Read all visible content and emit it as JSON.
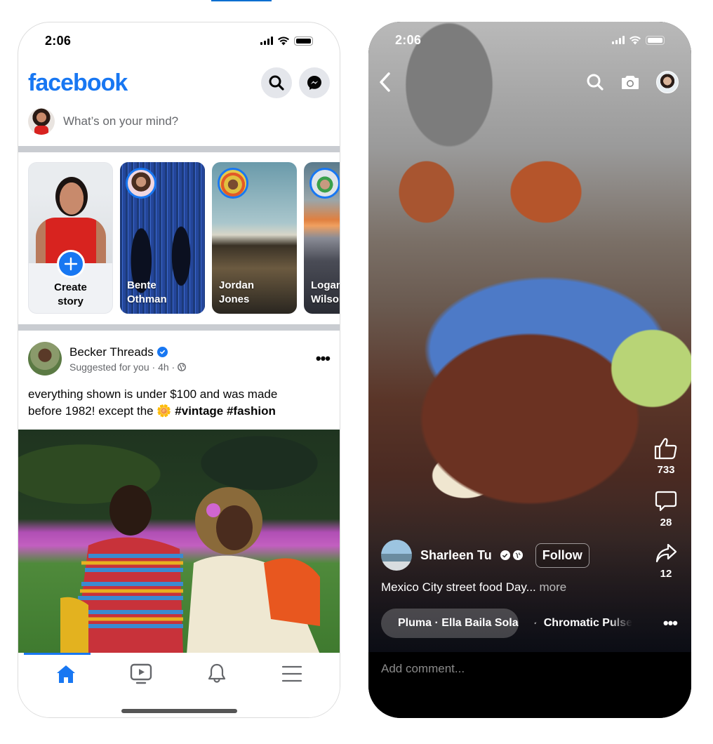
{
  "left_phone": {
    "status": {
      "time": "2:06"
    },
    "header": {
      "logo": "facebook",
      "search_icon": "search-icon",
      "messenger_icon": "messenger-icon"
    },
    "composer": {
      "placeholder": "What’s on your mind?"
    },
    "stories": [
      {
        "label_line1": "Create",
        "label_line2": "story",
        "type": "create"
      },
      {
        "label_line1": "Bente",
        "label_line2": "Othman"
      },
      {
        "label_line1": "Jordan",
        "label_line2": "Jones"
      },
      {
        "label_line1": "Logan",
        "label_line2": "Wilson"
      }
    ],
    "post": {
      "author": "Becker Threads",
      "verified": true,
      "meta": "Suggested for you · 4h ·",
      "text_line1": "everything shown is under $100 and was made",
      "text_line2_prefix": "before 1982! except the",
      "emoji": "🌼",
      "hashtags": "#vintage #fashion"
    },
    "tabbar": {
      "tabs": [
        {
          "name": "home",
          "active": true
        },
        {
          "name": "watch",
          "active": false
        },
        {
          "name": "notifications",
          "active": false
        },
        {
          "name": "menu",
          "active": false
        }
      ]
    }
  },
  "right_phone": {
    "status": {
      "time": "2:06"
    },
    "reel": {
      "author": "Sharleen Tu",
      "follow_label": "Follow",
      "caption": "Mexico City street food Day...",
      "caption_more": "more",
      "likes": "733",
      "comments": "28",
      "shares": "12",
      "music": "Pluma · Ella Baila Sola",
      "effect": "Chromatic Pulse"
    },
    "comment_placeholder": "Add comment..."
  },
  "colors": {
    "brand": "#1877f2",
    "divider": "#c9ccd1",
    "secondary_text": "#65676b"
  }
}
